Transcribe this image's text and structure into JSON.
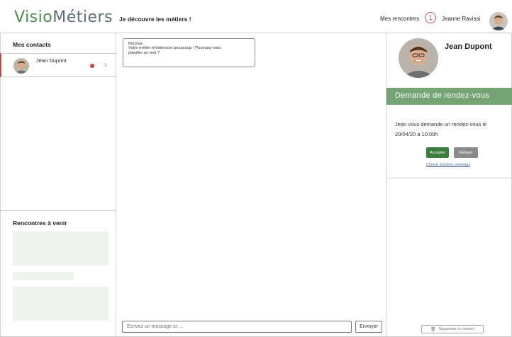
{
  "header": {
    "logo_part1": "Visio",
    "logo_part2": "Métiers",
    "title": "Je découvre les métiers !",
    "rencontres_label": "Mes rencontres",
    "rencontres_count": "1",
    "user_name": "Jeanne Ravissi"
  },
  "left": {
    "contacts_title": "Mes contacts",
    "contacts": [
      {
        "name": "Jean Dupont",
        "unread": true
      }
    ],
    "upcoming_title": "Rencontres à venir"
  },
  "chat": {
    "message_lines": [
      "Bonjour,",
      "Votre métier m'intéresse beaucoup ! Pouvons-nous",
      "planifier un test ?"
    ],
    "input_placeholder": "Ecrivez un message ici ...",
    "send_label": "Envoyer"
  },
  "right": {
    "contact_name": "Jean Dupont",
    "request_title": "Demande de rendez-vous",
    "request_text": "Jean vous demande un rendez-vous le 20/04/20 à 10:00h",
    "accept_label": "Accepter",
    "refuse_label": "Refuser",
    "other_slots_label": "Choisir d'autres créneaux",
    "delete_label": "Supprimer le contact"
  },
  "colors": {
    "brand_green": "#74a474",
    "accept_green": "#3c7d3c",
    "badge_red": "#d9534f",
    "placeholder_green": "#eef3ee"
  }
}
